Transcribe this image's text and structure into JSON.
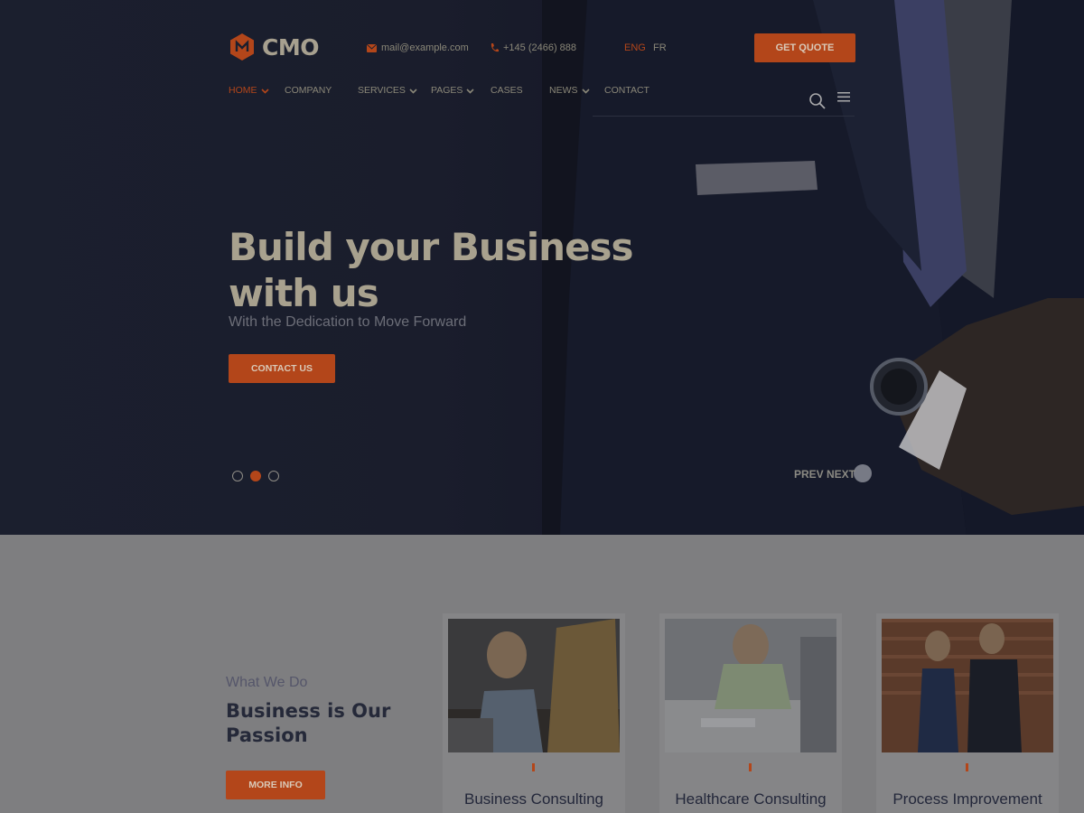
{
  "brand": {
    "name": "CMO",
    "accent": "#b3461a"
  },
  "header": {
    "email": "mail@example.com",
    "phone": "+145 (2466) 888",
    "languages": [
      "ENG",
      "FR"
    ],
    "active_language": "ENG",
    "quote_label": "GET QUOTE",
    "email_icon": "envelope-icon",
    "phone_icon": "phone-icon"
  },
  "nav": {
    "items": [
      {
        "label": "HOME",
        "has_dropdown": true,
        "active": true
      },
      {
        "label": "COMPANY",
        "has_dropdown": false
      },
      {
        "label": "SERVICES",
        "has_dropdown": true
      },
      {
        "label": "PAGES",
        "has_dropdown": true
      },
      {
        "label": "CASES",
        "has_dropdown": false
      },
      {
        "label": "NEWS",
        "has_dropdown": true
      },
      {
        "label": "CONTACT",
        "has_dropdown": false
      }
    ],
    "search_icon": "search-icon",
    "menu_icon": "hamburger-icon"
  },
  "hero": {
    "title": "Build your Business with us",
    "subtitle": "With the Dedication to Move Forward",
    "cta_label": "CONTACT US",
    "slides": 3,
    "active_slide": 2,
    "prev_label": "PREV",
    "next_label": "NEXT"
  },
  "section": {
    "eyebrow": "What We Do",
    "title": "Business is Our Passion",
    "button_label": "MORE INFO",
    "cards": [
      {
        "title": "Business Consulting"
      },
      {
        "title": "Healthcare Consulting"
      },
      {
        "title": "Process Improvement"
      }
    ]
  }
}
